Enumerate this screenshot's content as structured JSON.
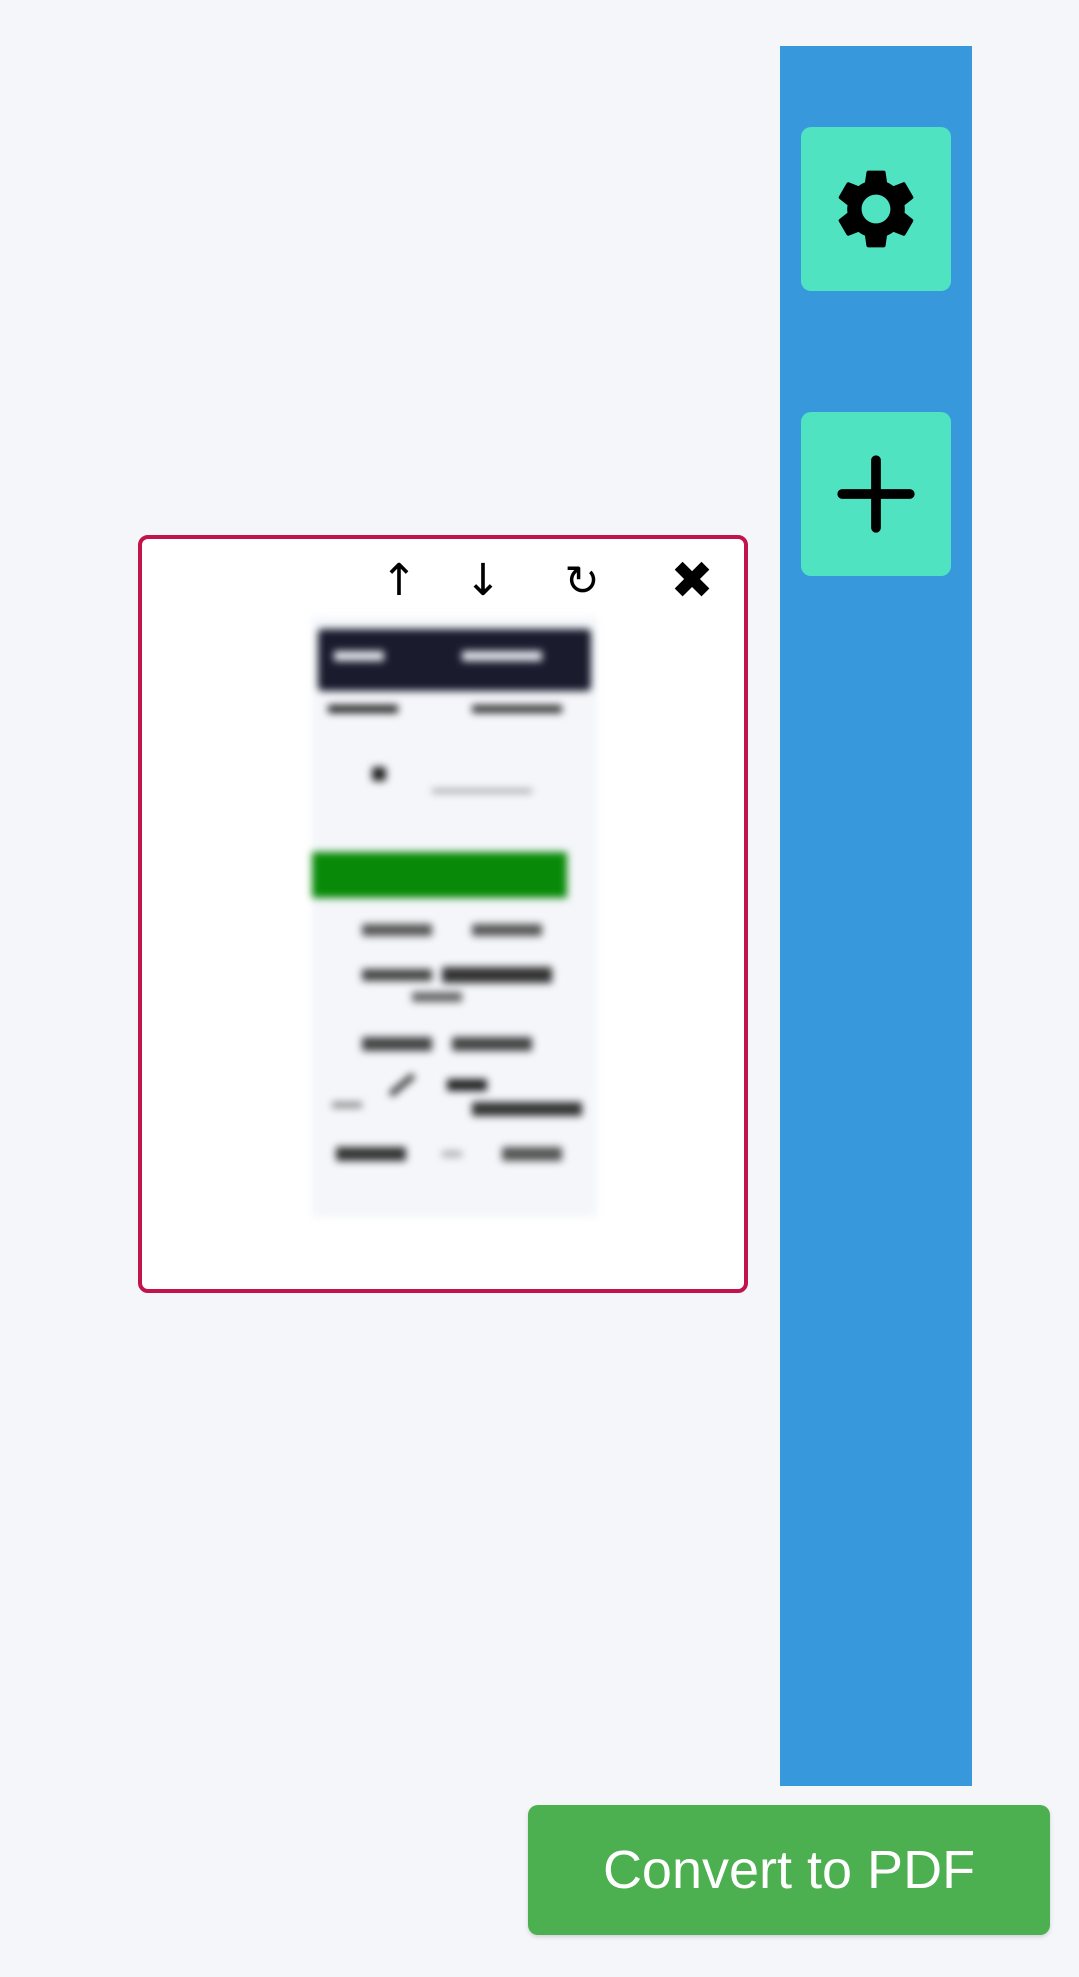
{
  "sidebar": {
    "settings_icon": "gear-icon",
    "add_icon": "plus-icon",
    "background": "#3799db",
    "button_color": "#50e3c2"
  },
  "page_card": {
    "controls": {
      "move_up": "↑",
      "move_down": "↓",
      "rotate": "↻",
      "remove": "✖"
    },
    "border_color": "#c0144a"
  },
  "actions": {
    "convert_label": "Convert to PDF",
    "convert_color": "#4caf50"
  }
}
